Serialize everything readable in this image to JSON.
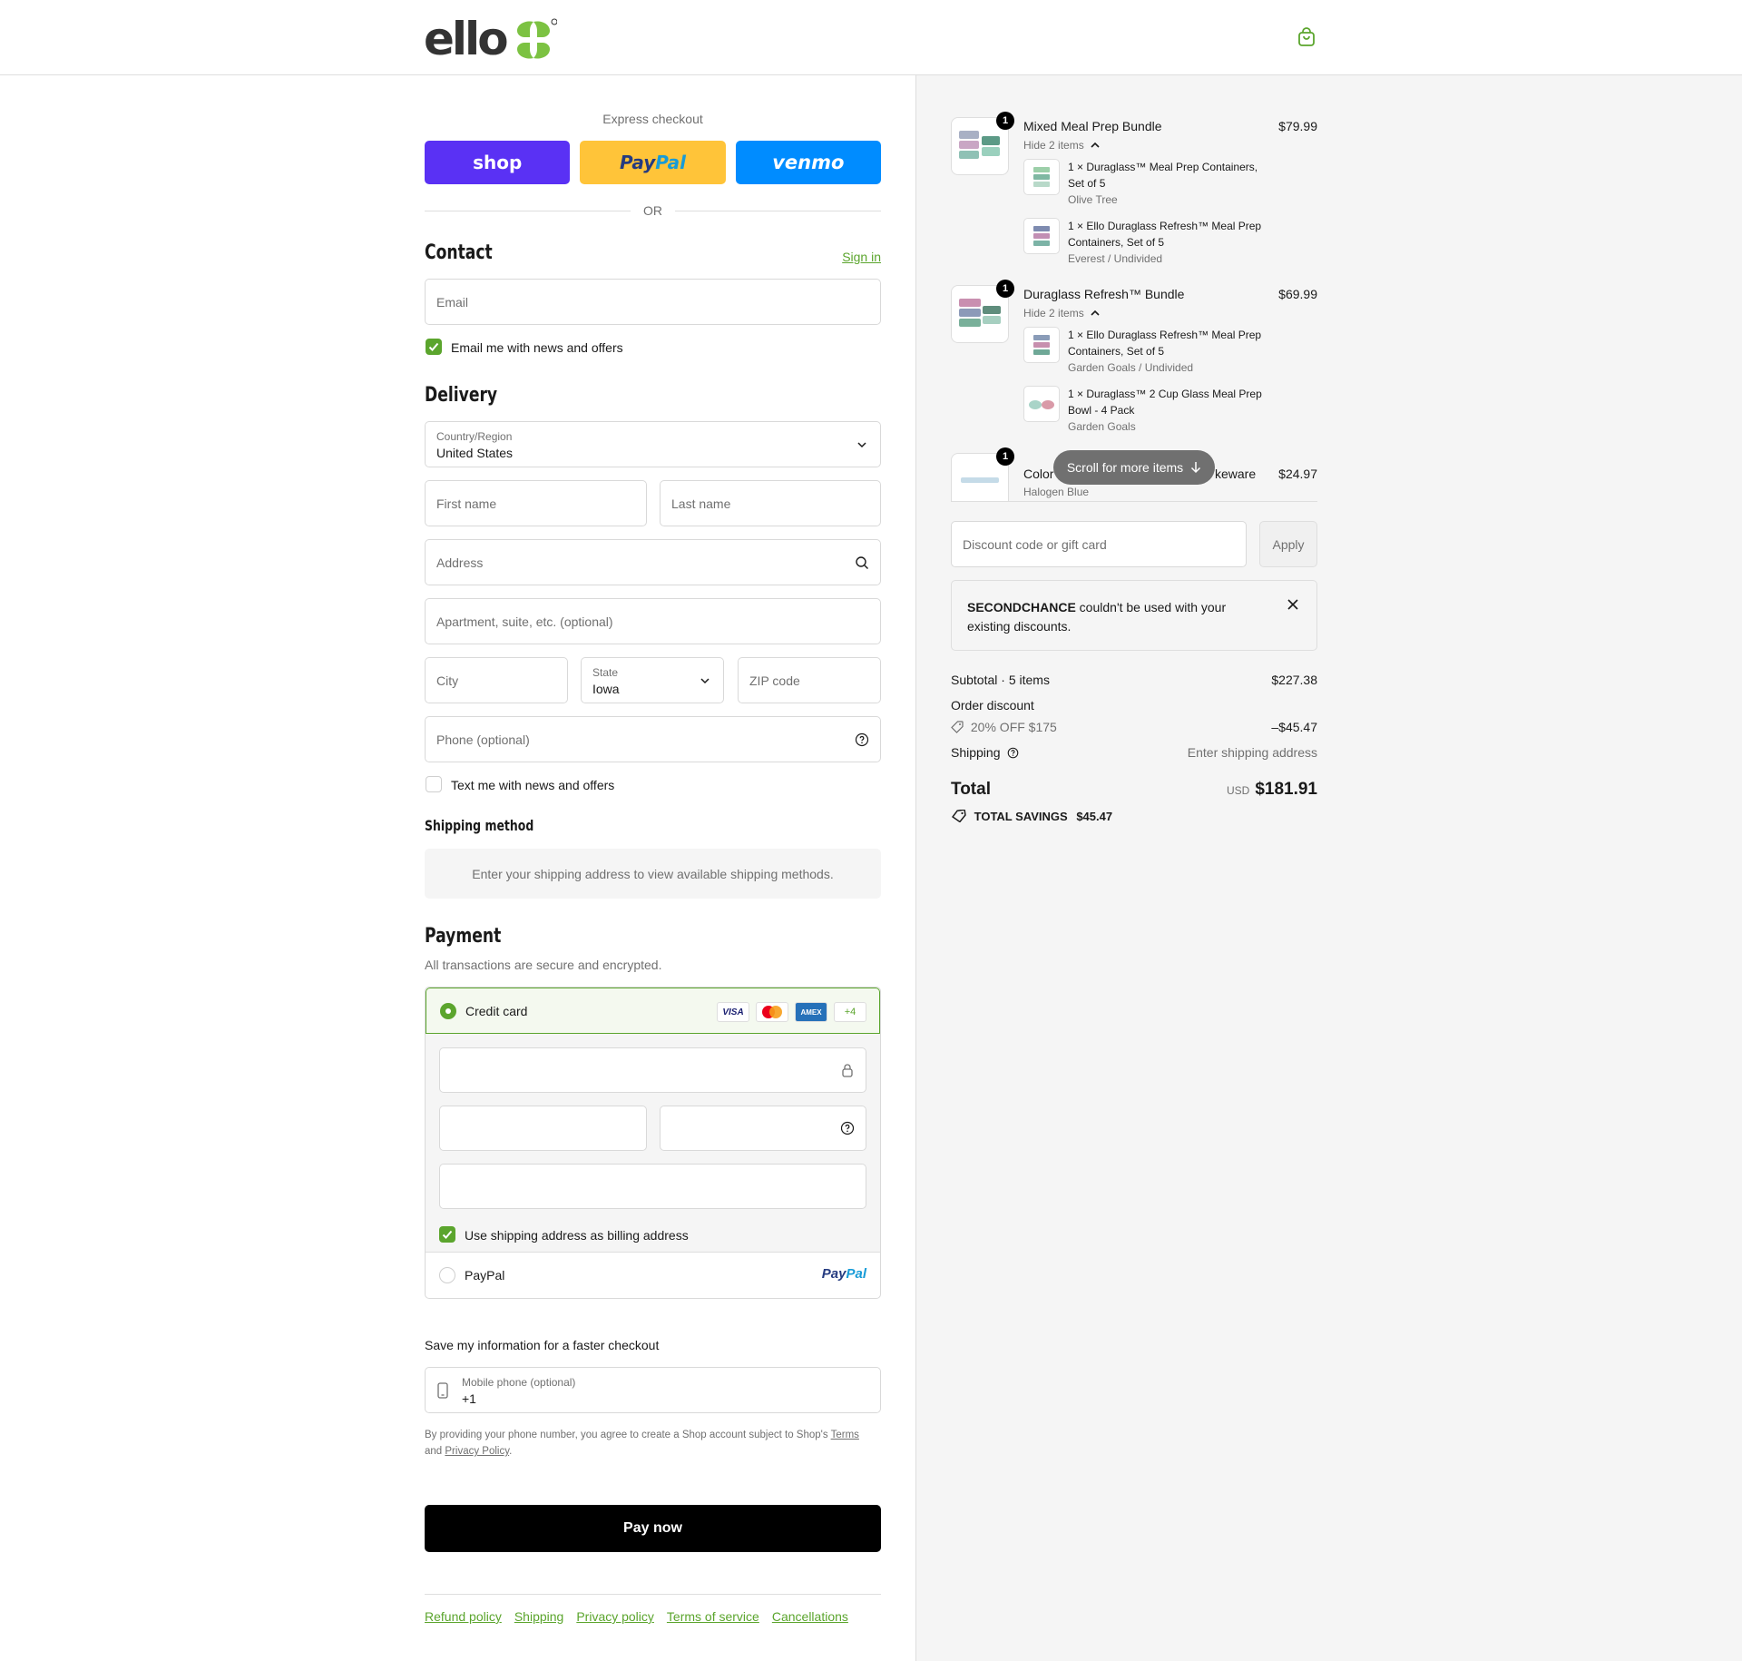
{
  "header": {
    "brand": "ello"
  },
  "express": {
    "title": "Express checkout",
    "shop_label": "shop",
    "paypal_label_a": "Pay",
    "paypal_label_b": "Pal",
    "venmo_label": "venmo",
    "or_label": "OR"
  },
  "contact": {
    "heading": "Contact",
    "sign_in": "Sign in",
    "email_placeholder": "Email",
    "news_label": "Email me with news and offers"
  },
  "delivery": {
    "heading": "Delivery",
    "country_label": "Country/Region",
    "country_value": "United States",
    "first_name": "First name",
    "last_name": "Last name",
    "address": "Address",
    "apartment": "Apartment, suite, etc. (optional)",
    "city": "City",
    "state_label": "State",
    "state_value": "Iowa",
    "zip": "ZIP code",
    "phone": "Phone (optional)",
    "text_label": "Text me with news and offers"
  },
  "shipping_method": {
    "heading": "Shipping method",
    "info": "Enter your shipping address to view available shipping methods."
  },
  "payment": {
    "heading": "Payment",
    "subtitle": "All transactions are secure and encrypted.",
    "credit_card_label": "Credit card",
    "cards": [
      "VISA",
      "",
      "AMEX",
      "+4"
    ],
    "billing_label": "Use shipping address as billing address",
    "paypal_label": "PayPal",
    "paypal_logo_a": "Pay",
    "paypal_logo_b": "Pal"
  },
  "save_info": {
    "heading": "Save my information for a faster checkout",
    "mobile_label": "Mobile phone (optional)",
    "mobile_value": "+1",
    "legal_a": "By providing your phone number, you agree to create a Shop account subject to Shop's",
    "terms": "Terms",
    "legal_and": "and",
    "privacy": "Privacy Policy",
    "legal_end": "."
  },
  "pay_now": "Pay now",
  "footer_links": [
    "Refund policy",
    "Shipping",
    "Privacy policy",
    "Terms of service",
    "Cancellations"
  ],
  "order": {
    "items": [
      {
        "qty": "1",
        "name": "Mixed Meal Prep Bundle",
        "price": "$79.99",
        "hide": "Hide 2 items",
        "sub": [
          {
            "name": "1 × Duraglass™ Meal Prep Containers, Set of 5",
            "variant": "Olive Tree"
          },
          {
            "name": "1 × Ello Duraglass Refresh™ Meal Prep Containers, Set of 5",
            "variant": "Everest / Undivided"
          }
        ]
      },
      {
        "qty": "1",
        "name": "Duraglass Refresh™ Bundle",
        "price": "$69.99",
        "hide": "Hide 2 items",
        "sub": [
          {
            "name": "1 × Ello Duraglass Refresh™ Meal Prep Containers, Set of 5",
            "variant": "Garden Goals / Undivided"
          },
          {
            "name": "1 × Duraglass™ 2 Cup Glass Meal Prep Bowl - 4 Pack",
            "variant": "Garden Goals"
          }
        ]
      },
      {
        "qty": "1",
        "name_a": "Color",
        "name_b": "keware",
        "price": "$24.97",
        "variant": "Halogen Blue"
      }
    ],
    "scroll_hint": "Scroll for more items",
    "discount_placeholder": "Discount code or gift card",
    "apply": "Apply",
    "notice_code": "SECONDCHANCE",
    "notice_text": " couldn't be used with your existing discounts.",
    "subtotal_label": "Subtotal · 5 items",
    "subtotal_value": "$227.38",
    "order_discount_label": "Order discount",
    "discount_name": "20% OFF $175",
    "discount_value": "–$45.47",
    "shipping_label": "Shipping",
    "shipping_value": "Enter shipping address",
    "total_label": "Total",
    "currency": "USD",
    "total_value": "$181.91",
    "savings_label": "TOTAL SAVINGS",
    "savings_value": "$45.47"
  },
  "colors": {
    "accent": "#5ba52d",
    "shop": "#5a31f4",
    "paypal": "#ffc439",
    "venmo": "#008cff"
  }
}
